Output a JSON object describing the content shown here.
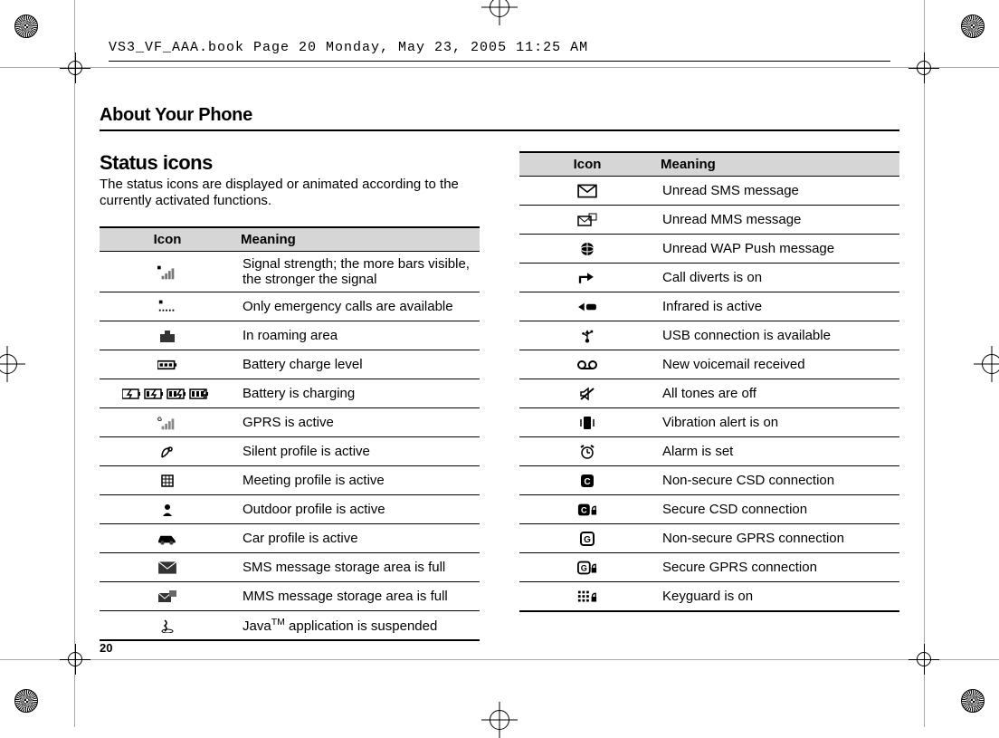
{
  "header_line": "VS3_VF_AAA.book  Page 20  Monday, May 23, 2005  11:25 AM",
  "section_label": "About Your Phone",
  "heading": "Status icons",
  "intro": "The status icons are displayed or animated according to the currently activated functions.",
  "table_header_icon": "Icon",
  "table_header_meaning": "Meaning",
  "page_number": "20",
  "left_rows": [
    {
      "icon": "signal",
      "meaning": "Signal strength; the more bars visible, the stronger the signal"
    },
    {
      "icon": "emergency",
      "meaning": "Only emergency calls are available"
    },
    {
      "icon": "roaming",
      "meaning": "In roaming area"
    },
    {
      "icon": "battery",
      "meaning": "Battery charge level"
    },
    {
      "icon": "charging",
      "meaning": "Battery is charging"
    },
    {
      "icon": "gprs",
      "meaning": "GPRS is active"
    },
    {
      "icon": "silent",
      "meaning": "Silent profile is active"
    },
    {
      "icon": "meeting",
      "meaning": "Meeting profile is active"
    },
    {
      "icon": "outdoor",
      "meaning": "Outdoor profile is active"
    },
    {
      "icon": "car",
      "meaning": "Car profile is active"
    },
    {
      "icon": "smsfull",
      "meaning": "SMS message storage area is full"
    },
    {
      "icon": "mmsfull",
      "meaning": "MMS message storage area is full"
    },
    {
      "icon": "java",
      "meaning_html": "Java<sup>TM</sup> application is suspended"
    }
  ],
  "right_rows": [
    {
      "icon": "sms",
      "meaning": "Unread SMS message"
    },
    {
      "icon": "mms",
      "meaning": "Unread MMS message"
    },
    {
      "icon": "wap",
      "meaning": "Unread WAP Push message"
    },
    {
      "icon": "divert",
      "meaning": "Call diverts is on"
    },
    {
      "icon": "infrared",
      "meaning": "Infrared is active"
    },
    {
      "icon": "usb",
      "meaning": "USB connection is available"
    },
    {
      "icon": "voicemail",
      "meaning": "New voicemail received"
    },
    {
      "icon": "mute",
      "meaning": "All tones are off"
    },
    {
      "icon": "vibrate",
      "meaning": "Vibration alert is on"
    },
    {
      "icon": "alarm",
      "meaning": "Alarm is set"
    },
    {
      "icon": "csd",
      "meaning": "Non-secure CSD connection"
    },
    {
      "icon": "csd-sec",
      "meaning": "Secure CSD connection"
    },
    {
      "icon": "gprs-conn",
      "meaning": "Non-secure GPRS connection"
    },
    {
      "icon": "gprs-sec",
      "meaning": "Secure GPRS connection"
    },
    {
      "icon": "keyguard",
      "meaning": "Keyguard is on"
    }
  ]
}
